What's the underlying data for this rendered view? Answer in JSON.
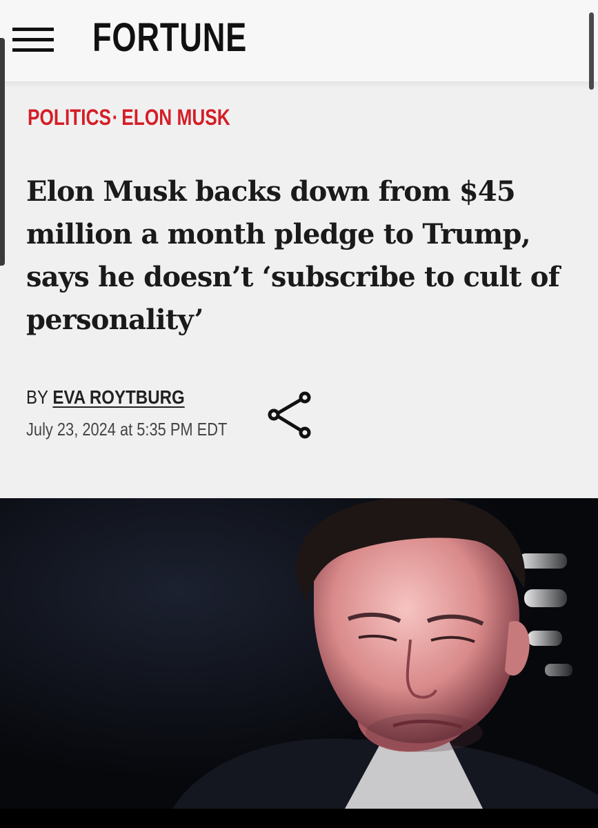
{
  "header": {
    "logo": "FORTUNE",
    "menu_icon": "hamburger-menu-icon"
  },
  "breadcrumb": {
    "section": "POLITICS",
    "separator": "·",
    "topic": "ELON MUSK"
  },
  "article": {
    "headline": "Elon Musk backs down from $45 million a month pledge to Trump, says he doesn’t ‘subscribe to cult of personality’",
    "by_label": "BY",
    "author": "EVA ROYTBURG",
    "date": "July 23, 2024 at 5:35 PM EDT",
    "share_icon": "share-icon"
  },
  "colors": {
    "accent": "#d41e26",
    "text": "#1a1a1a",
    "background": "#f0f0f1",
    "photo_background": "#0b0d12"
  }
}
